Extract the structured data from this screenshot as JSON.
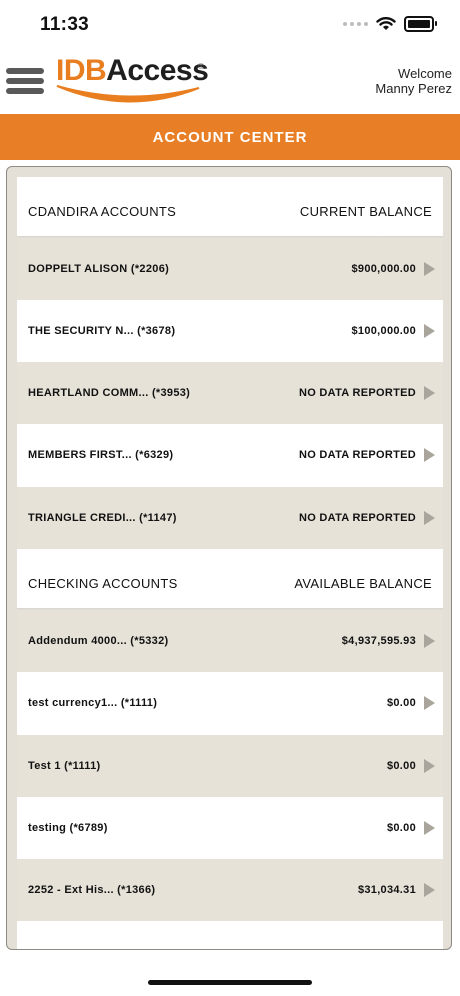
{
  "status": {
    "time": "11:33"
  },
  "header": {
    "logo": {
      "part1": "IDB",
      "part2": "Access",
      "mark": "®"
    },
    "welcome_line1": "Welcome",
    "welcome_line2": "Manny Perez"
  },
  "title": "ACCOUNT CENTER",
  "cdandira": {
    "header_left": "CDANDIRA ACCOUNTS",
    "header_right": "CURRENT BALANCE",
    "rows": [
      {
        "name": "DOPPELT ALISON (*2206)",
        "value": "$900,000.00"
      },
      {
        "name": "THE SECURITY N...  (*3678)",
        "value": "$100,000.00"
      },
      {
        "name": "HEARTLAND COMM...  (*3953)",
        "value": "NO DATA REPORTED"
      },
      {
        "name": "MEMBERS FIRST...  (*6329)",
        "value": "NO DATA REPORTED"
      },
      {
        "name": "TRIANGLE CREDI...  (*1147)",
        "value": "NO DATA REPORTED"
      }
    ]
  },
  "checking": {
    "header_left": "CHECKING ACCOUNTS",
    "header_right": "AVAILABLE BALANCE",
    "rows": [
      {
        "name": "Addendum 4000...  (*5332)",
        "value": "$4,937,595.93"
      },
      {
        "name": "test currency1...  (*1111)",
        "value": "$0.00"
      },
      {
        "name": "Test 1 (*1111)",
        "value": "$0.00"
      },
      {
        "name": "testing (*6789)",
        "value": "$0.00"
      },
      {
        "name": "2252 - Ext His...  (*1366)",
        "value": "$31,034.31"
      }
    ]
  }
}
